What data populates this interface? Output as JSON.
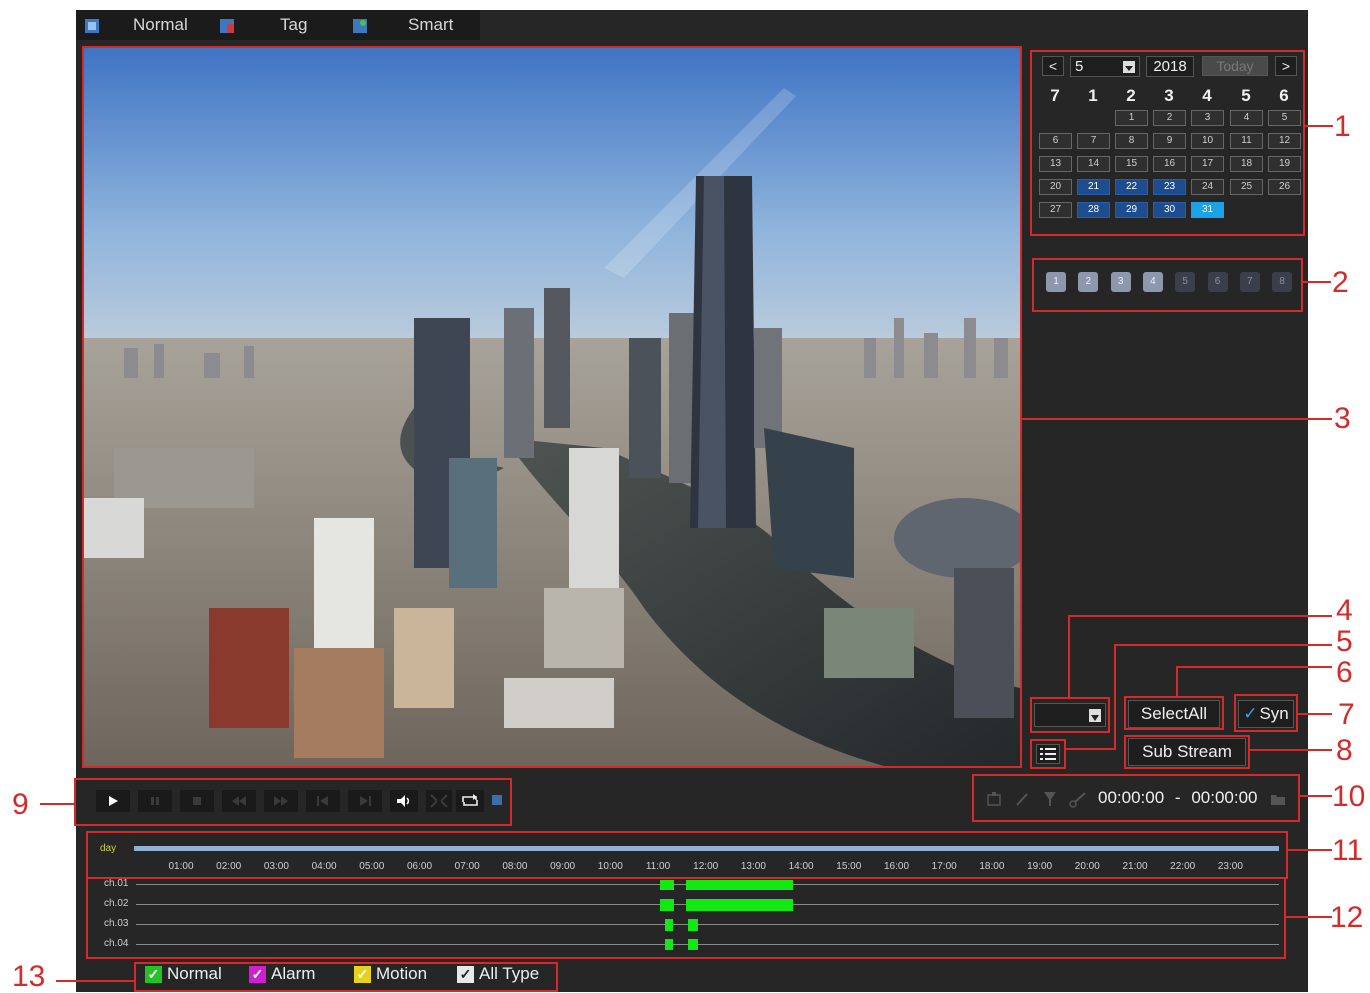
{
  "tabs": [
    {
      "label": "Normal"
    },
    {
      "label": "Tag"
    },
    {
      "label": "Smart"
    }
  ],
  "calendar": {
    "prev": "<",
    "next": ">",
    "month": "5",
    "year": "2018",
    "today_label": "Today",
    "weekdays": [
      "7",
      "1",
      "2",
      "3",
      "4",
      "5",
      "6"
    ],
    "days": [
      "1",
      "2",
      "3",
      "4",
      "5",
      "6",
      "7",
      "8",
      "9",
      "10",
      "11",
      "12",
      "13",
      "14",
      "15",
      "16",
      "17",
      "18",
      "19",
      "20",
      "21",
      "22",
      "23",
      "24",
      "25",
      "26",
      "27",
      "28",
      "29",
      "30",
      "31"
    ],
    "recorded_days": [
      "21",
      "22",
      "23",
      "28",
      "29",
      "30"
    ],
    "selected_day": "31"
  },
  "channels": [
    {
      "label": "1",
      "active": true
    },
    {
      "label": "2",
      "active": true
    },
    {
      "label": "3",
      "active": true
    },
    {
      "label": "4",
      "active": true
    },
    {
      "label": "5",
      "active": false
    },
    {
      "label": "6",
      "active": false
    },
    {
      "label": "7",
      "active": false
    },
    {
      "label": "8",
      "active": false
    }
  ],
  "buttons": {
    "select_all": "SelectAll",
    "syn": "Syn",
    "sub_stream": "Sub Stream"
  },
  "clip": {
    "start": "00:00:00",
    "separator": "-",
    "end": "00:00:00"
  },
  "timeline": {
    "scale_label": "day",
    "hours": [
      "01:00",
      "02:00",
      "03:00",
      "04:00",
      "05:00",
      "06:00",
      "07:00",
      "08:00",
      "09:00",
      "10:00",
      "11:00",
      "12:00",
      "13:00",
      "14:00",
      "15:00",
      "16:00",
      "17:00",
      "18:00",
      "19:00",
      "20:00",
      "21:00",
      "22:00",
      "23:00"
    ],
    "channels": [
      "ch.01",
      "ch.02",
      "ch.03",
      "ch.04"
    ]
  },
  "legend": [
    {
      "label": "Normal",
      "color": "#22c322"
    },
    {
      "label": "Alarm",
      "color": "#d21ed2"
    },
    {
      "label": "Motion",
      "color": "#e6d21e"
    },
    {
      "label": "All Type",
      "color": "#e8e8e8"
    }
  ],
  "callouts": [
    "1",
    "2",
    "3",
    "4",
    "5",
    "6",
    "7",
    "8",
    "9",
    "10",
    "11",
    "12",
    "13"
  ],
  "colors": {
    "record": "#12e812",
    "annotation": "#d42a2a",
    "selected_day": "#1aa3e8",
    "recorded_day": "#1d4d8f"
  }
}
